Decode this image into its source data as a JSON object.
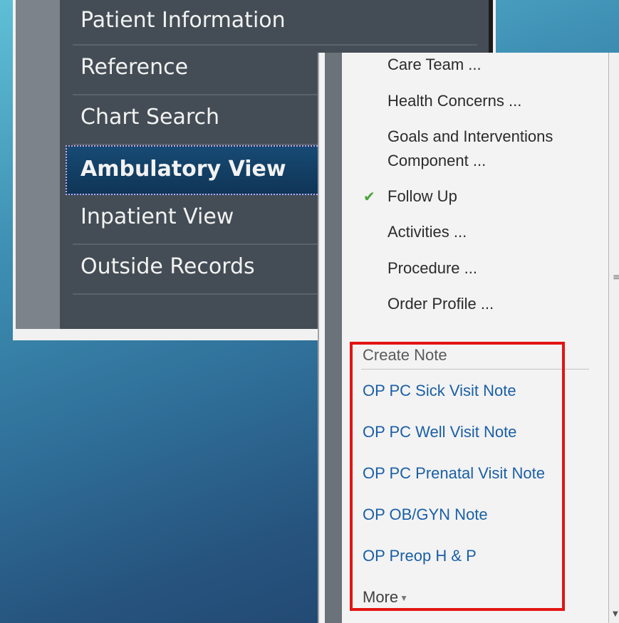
{
  "nav": {
    "items": [
      {
        "label": "Patient Information"
      },
      {
        "label": "Reference"
      },
      {
        "label": "Chart Search"
      },
      {
        "label": "Ambulatory View",
        "selected": true
      },
      {
        "label": "Inpatient View"
      },
      {
        "label": "Outside Records"
      }
    ]
  },
  "menu": {
    "items": [
      {
        "label": "Care Team ..."
      },
      {
        "label": "Health Concerns ..."
      },
      {
        "label": "Goals and Interventions"
      },
      {
        "label": "Component ..."
      },
      {
        "label": "Follow Up",
        "checked": true
      },
      {
        "label": "Activities ..."
      },
      {
        "label": "Procedure ..."
      },
      {
        "label": "Order Profile ..."
      }
    ],
    "check_icon": "check-icon",
    "create_note": {
      "header": "Create Note",
      "links": [
        {
          "label": "OP PC Sick Visit Note"
        },
        {
          "label": "OP PC Well Visit Note"
        },
        {
          "label": "OP PC Prenatal Visit Note"
        },
        {
          "label": "OP OB/GYN Note"
        },
        {
          "label": "OP Preop H & P"
        }
      ],
      "more_label": "More"
    },
    "highlight_color": "#e31414",
    "link_color": "#1a5fa6"
  }
}
